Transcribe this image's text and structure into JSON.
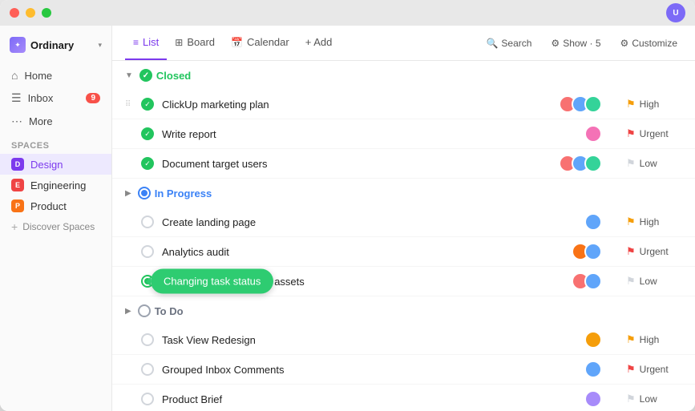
{
  "window": {
    "title": "Ordinary"
  },
  "sidebar": {
    "workspace_label": "Ordinary",
    "nav_items": [
      {
        "id": "home",
        "label": "Home",
        "icon": "🏠"
      },
      {
        "id": "inbox",
        "label": "Inbox",
        "icon": "📥",
        "badge": "9"
      },
      {
        "id": "more",
        "label": "More",
        "icon": "•••"
      }
    ],
    "spaces_label": "Spaces",
    "spaces": [
      {
        "id": "design",
        "label": "Design",
        "color": "#7c3aed",
        "initial": "D",
        "active": true
      },
      {
        "id": "engineering",
        "label": "Engineering",
        "color": "#ef4444",
        "initial": "E",
        "active": false
      },
      {
        "id": "product",
        "label": "Product",
        "color": "#f97316",
        "initial": "P",
        "active": false
      }
    ],
    "discover_label": "Discover Spaces"
  },
  "tabs": [
    {
      "id": "list",
      "label": "List",
      "active": true
    },
    {
      "id": "board",
      "label": "Board",
      "active": false
    },
    {
      "id": "calendar",
      "label": "Calendar",
      "active": false
    }
  ],
  "toolbar": {
    "add_label": "+ Add",
    "search_label": "Search",
    "show_label": "Show · 5",
    "customize_label": "Customize"
  },
  "groups": [
    {
      "id": "closed",
      "label": "Closed",
      "status_color": "#22c55e",
      "collapsed": false,
      "tasks": [
        {
          "id": "t1",
          "name": "ClickUp marketing plan",
          "avatars": [
            "#f87171",
            "#60a5fa",
            "#34d399"
          ],
          "priority": "High",
          "priority_color": "orange",
          "status": "done"
        },
        {
          "id": "t2",
          "name": "Write report",
          "avatars": [
            "#f472b6"
          ],
          "priority": "Urgent",
          "priority_color": "red",
          "status": "done"
        },
        {
          "id": "t3",
          "name": "Document target users",
          "avatars": [
            "#f87171",
            "#60a5fa",
            "#34d399"
          ],
          "priority": "Low",
          "priority_color": "gray",
          "status": "done"
        }
      ]
    },
    {
      "id": "in-progress",
      "label": "In Progress",
      "status_color": "#3b82f6",
      "collapsed": false,
      "tasks": [
        {
          "id": "t4",
          "name": "Create landing page",
          "avatars": [
            "#60a5fa"
          ],
          "priority": "High",
          "priority_color": "orange",
          "status": "open"
        },
        {
          "id": "t5",
          "name": "Analytics audit",
          "avatars": [
            "#f97316",
            "#60a5fa"
          ],
          "priority": "Urgent",
          "priority_color": "red",
          "status": "open"
        },
        {
          "id": "t6",
          "name": "Spring campaign image assets",
          "avatars": [
            "#f87171",
            "#60a5fa"
          ],
          "priority": "Low",
          "priority_color": "gray",
          "status": "changing",
          "tooltip": "Changing task status"
        }
      ]
    },
    {
      "id": "todo",
      "label": "To Do",
      "status_color": "#9ca3af",
      "collapsed": false,
      "tasks": [
        {
          "id": "t7",
          "name": "Task View Redesign",
          "avatars": [
            "#f59e0b"
          ],
          "priority": "High",
          "priority_color": "orange",
          "status": "open"
        },
        {
          "id": "t8",
          "name": "Grouped Inbox Comments",
          "avatars": [
            "#60a5fa"
          ],
          "priority": "Urgent",
          "priority_color": "red",
          "status": "open"
        },
        {
          "id": "t9",
          "name": "Product Brief",
          "avatars": [
            "#a78bfa"
          ],
          "priority": "Low",
          "priority_color": "gray",
          "status": "open"
        }
      ]
    }
  ]
}
